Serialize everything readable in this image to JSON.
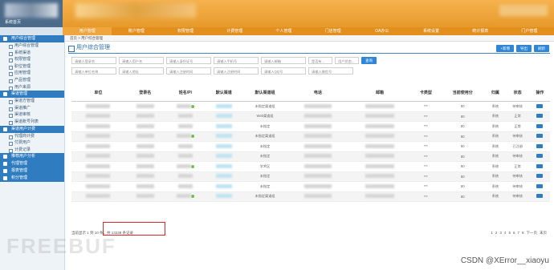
{
  "app": {
    "logo_text": "系统首页"
  },
  "nav": [
    "用户管理",
    "账户管理",
    "权限管理",
    "计费管理",
    "个人管理",
    "门店管理",
    "OA办公",
    "系统设置",
    "统计报表",
    "门户管理"
  ],
  "sidebar": {
    "sections": [
      {
        "label": "用户综合管理",
        "items": [
          "用户综合管理",
          "系统渠道",
          "权限管理",
          "职位管理",
          "应用管理",
          "产品管理",
          "用户来源"
        ]
      },
      {
        "label": "渠道管理",
        "items": [
          "渠道方管理",
          "渠道推广",
          "渠道审核",
          "渠道账号列表"
        ]
      },
      {
        "label": "渠道用户计费",
        "items": [
          "代理商计费",
          "付费用户",
          "计费记录"
        ]
      },
      {
        "label": "推荐用户分析",
        "items": []
      },
      {
        "label": "代理管理",
        "items": []
      },
      {
        "label": "报表管理",
        "items": []
      },
      {
        "label": "积分管理",
        "items": []
      }
    ]
  },
  "breadcrumb": "首页 > 用户综合管理",
  "page": {
    "title": "用户综合管理",
    "buttons": [
      "+新增",
      "导出",
      "刷新"
    ]
  },
  "filters": {
    "row1": [
      "请输入登录名",
      "请输入用户名",
      "请输入身份证号",
      "请输入手机号",
      "请输入邮箱"
    ],
    "row1_selects": [
      "是否有...",
      "用户状态..."
    ],
    "search_label": "查询",
    "row2": [
      "请输入单位名称",
      "请输入地址",
      "请输入注册时间",
      "请输入注册时间",
      "请输入QQ号",
      "请输入微信号"
    ]
  },
  "table": {
    "headers": [
      "单位",
      "登录名",
      "姓名/PI",
      "默认渠道",
      "默认渠道组",
      "电话",
      "邮箱",
      "卡类型",
      "当前使用分",
      "归属",
      "状态",
      "操作"
    ],
    "rows": [
      {
        "channel_group": "未指定渠道组",
        "card": "***",
        "points": "80",
        "owner": "系统",
        "status": "待审核",
        "red": true
      },
      {
        "channel_group": "Web渠道组",
        "card": "***",
        "points": "80",
        "owner": "系统",
        "status": "正常",
        "red": false
      },
      {
        "channel_group": "未指定",
        "card": "***",
        "points": "80",
        "owner": "系统",
        "status": "正常",
        "red": false
      },
      {
        "channel_group": "未指定渠道组",
        "card": "***",
        "points": "80",
        "owner": "系统",
        "status": "待审核",
        "red": true
      },
      {
        "channel_group": "未指定",
        "card": "***",
        "points": "80",
        "owner": "系统",
        "status": "已注册",
        "red": false
      },
      {
        "channel_group": "未指定",
        "card": "***",
        "points": "80",
        "owner": "系统",
        "status": "待审核",
        "red": true
      },
      {
        "channel_group": "学术区",
        "card": "***",
        "points": "80",
        "owner": "系统",
        "status": "正常",
        "red": false
      },
      {
        "channel_group": "未指定",
        "card": "***",
        "points": "80",
        "owner": "系统",
        "status": "待审核",
        "red": true
      },
      {
        "channel_group": "未指定",
        "card": "***",
        "points": "80",
        "owner": "系统",
        "status": "待审核",
        "red": true
      },
      {
        "channel_group": "未指定渠道组",
        "card": "***",
        "points": "80",
        "owner": "系统",
        "status": "待审核",
        "red": true
      }
    ]
  },
  "footer": {
    "info": "当前显示 1 到 10 条，共 13238 条记录",
    "pages": [
      "1",
      "2",
      "3",
      "4",
      "5",
      "6",
      "7",
      "8",
      "下一页",
      "末页"
    ]
  },
  "watermark": "FREEBUF",
  "credit": "CSDN @XError__xiaoyu"
}
